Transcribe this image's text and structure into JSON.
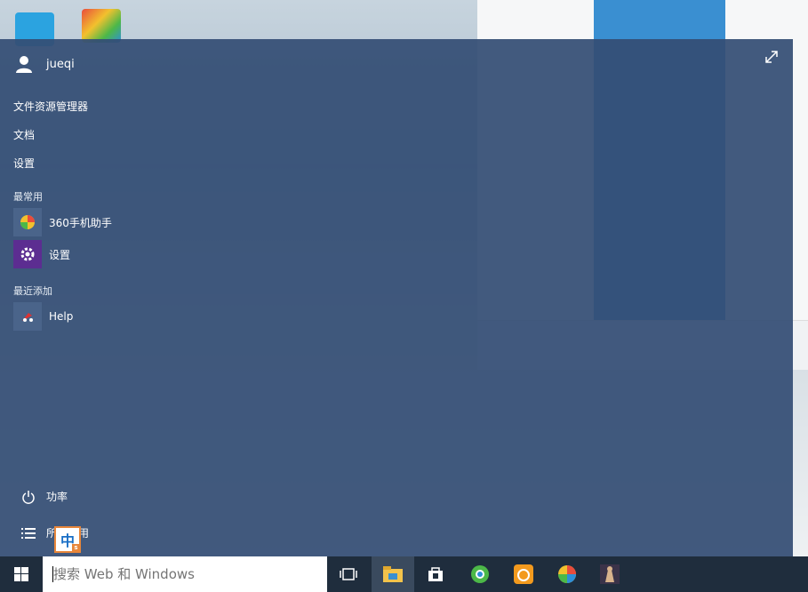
{
  "user": {
    "name": "jueqi"
  },
  "nav": {
    "file_explorer": "文件资源管理器",
    "documents": "文档",
    "settings": "设置"
  },
  "most_used": {
    "title": "最常用",
    "apps": [
      {
        "label": "360手机助手",
        "icon": "360-assistant-icon"
      },
      {
        "label": "设置",
        "icon": "gear-icon"
      }
    ]
  },
  "recently_added": {
    "title": "最近添加",
    "apps": [
      {
        "label": "Help",
        "icon": "help-icon"
      }
    ]
  },
  "bottom": {
    "power": "功率",
    "all_apps": "所有应用"
  },
  "ime": {
    "label": "中"
  },
  "search": {
    "placeholder": "搜索 Web 和 Windows"
  },
  "taskbar": {
    "icons": [
      "task-view-icon",
      "file-explorer-icon",
      "store-icon",
      "360-browser-icon",
      "uc-browser-icon",
      "360-assistant-icon",
      "game-icon"
    ]
  },
  "colors": {
    "start_bg": "#344e74",
    "taskbar_bg": "#1f2d3d",
    "settings_tile": "#5c2d91",
    "accent": "#3a8fd1"
  }
}
